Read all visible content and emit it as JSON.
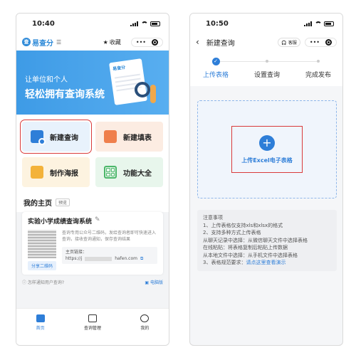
{
  "phone1": {
    "status": {
      "time": "10:40"
    },
    "nav": {
      "logo_text": "易查分",
      "logo_mark": "查",
      "menu_glyph": "☰",
      "favorite": "收藏",
      "more": "•••"
    },
    "banner": {
      "line1": "让单位和个人",
      "line2": "轻松拥有查询系统",
      "doc_label": "易查分"
    },
    "tiles": {
      "new_query": "新建查询",
      "new_form": "新建填表",
      "poster": "制作海报",
      "features": "功能大全"
    },
    "home": {
      "title": "我的主页",
      "preview": "预览"
    },
    "card": {
      "title": "实验小学成绩查询系统",
      "desc": "查询专用公众号二维码，发给查询者即可快速进入查询，接收查询通知，保存查询结果",
      "share": "分享二维码",
      "link_label": "主页链接：",
      "link_prefix": "https://j",
      "link_suffix": "hafen.com"
    },
    "help": {
      "question": "怎样通知用户查询?",
      "pc": "电脑版"
    },
    "tabs": {
      "home": "首页",
      "manage": "查询管理",
      "mine": "我的"
    }
  },
  "phone2": {
    "status": {
      "time": "10:50"
    },
    "nav": {
      "back": "‹",
      "title": "新建查询",
      "service": "客服",
      "more": "•••"
    },
    "steps": {
      "step1": "上传表格",
      "step2": "设置查询",
      "step3": "完成发布",
      "check": "✓"
    },
    "upload": {
      "plus": "+",
      "label": "上传Excel电子表格"
    },
    "notes": {
      "title": "注意事项",
      "l1": "1、上传表格仅支持xls和xlsx的格式",
      "l2": "2、支持多种方式上传表格",
      "l3": "从聊天记录中选择：从微信聊天文件中选择表格",
      "l4": "在线粘贴：将表格复制后粘贴上传数据",
      "l5": "从本地文件中选择：从手机文件中选择表格",
      "l6a": "3、表格规范要求：",
      "l6b": "请点这里查看演示"
    }
  },
  "colors": {
    "accent": "#2e7ed8",
    "highlight": "#d93a3a"
  }
}
